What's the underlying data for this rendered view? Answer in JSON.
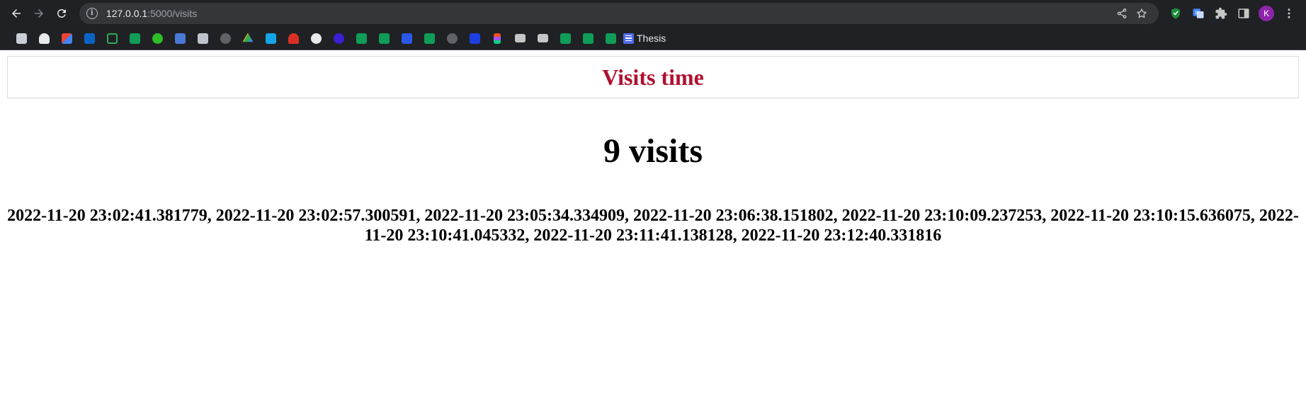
{
  "browser": {
    "url_host": "127.0.0.1",
    "url_rest": ":5000/visits",
    "profile_initial": "K",
    "bookmark_label": "Thesis"
  },
  "page": {
    "title": "Visits time",
    "count_text": "9 visits",
    "visits_text": "2022-11-20 23:02:41.381779, 2022-11-20 23:02:57.300591, 2022-11-20 23:05:34.334909, 2022-11-20 23:06:38.151802, 2022-11-20 23:10:09.237253, 2022-11-20 23:10:15.636075, 2022-11-20 23:10:41.045332, 2022-11-20 23:11:41.138128, 2022-11-20 23:12:40.331816"
  },
  "colors": {
    "title": "#b0102f",
    "chrome_bg": "#202124",
    "omnibox_bg": "#35363a"
  },
  "bookmark_icons": [
    "file-icon",
    "pocket-icon",
    "gmail-icon",
    "outlook-icon",
    "graph-icon",
    "sheets-icon",
    "green-p-icon",
    "translate-icon",
    "calculator-icon",
    "globe-icon",
    "drive-icon",
    "u-icon",
    "hat-icon",
    "openai-icon",
    "c-icon",
    "sheets-icon",
    "sheets-icon",
    "vk-icon",
    "sheets-icon",
    "globe-icon",
    "behance-icon",
    "figma-icon",
    "folder-icon",
    "folder-icon",
    "sheets-icon",
    "sheets-icon",
    "sheets-icon"
  ]
}
